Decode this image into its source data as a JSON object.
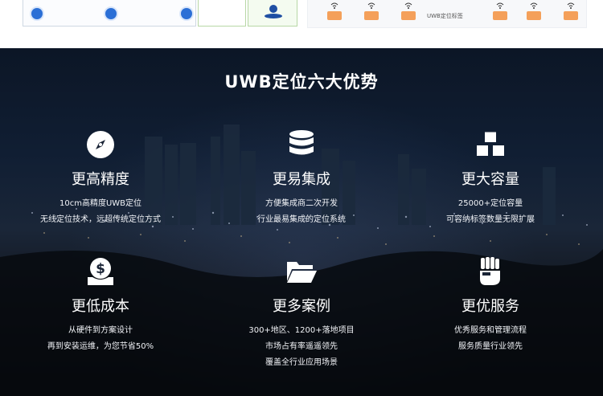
{
  "top_strip": {
    "tag_label": "UWB定位标签"
  },
  "section": {
    "title": "UWB定位六大优势"
  },
  "features": [
    {
      "icon": "compass-icon",
      "title": "更高精度",
      "lines": [
        "10cm高精度UWB定位",
        "无线定位技术，远超传统定位方式"
      ]
    },
    {
      "icon": "database-icon",
      "title": "更易集成",
      "lines": [
        "方便集成商二次开发",
        "行业最易集成的定位系统"
      ]
    },
    {
      "icon": "cubes-icon",
      "title": "更大容量",
      "lines": [
        "25000+定位容量",
        "可容纳标签数量无限扩展"
      ]
    },
    {
      "icon": "money-icon",
      "title": "更低成本",
      "lines": [
        "从硬件到方案设计",
        "再到安装运维，为您节省50%"
      ]
    },
    {
      "icon": "folder-open-icon",
      "title": "更多案例",
      "lines": [
        "300+地区、1200+落地项目",
        "市场占有率遥遥领先",
        "覆盖全行业应用场景"
      ]
    },
    {
      "icon": "fist-icon",
      "title": "更优服务",
      "lines": [
        "优秀服务和管理流程",
        "服务质量行业领先"
      ]
    }
  ],
  "colors": {
    "accent": "#2b6fd6",
    "anchor": "#f4a05a",
    "hero_bg": "#0c1626"
  }
}
